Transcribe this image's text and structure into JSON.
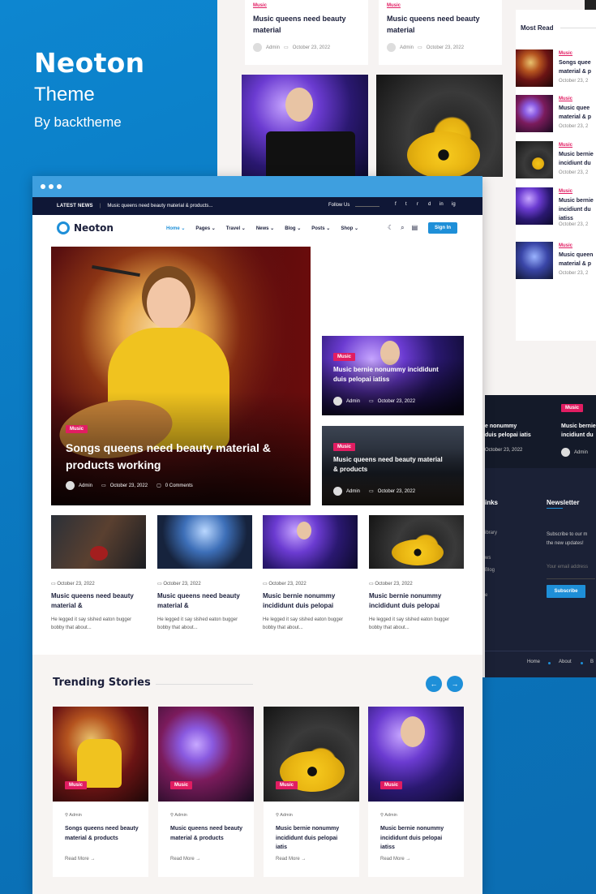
{
  "brand": {
    "name": "Neoton",
    "theme": "Theme",
    "by": "By backtheme"
  },
  "back": {
    "cards": [
      {
        "tag": "Music",
        "title": "Music queens need beauty material",
        "author": "Admin",
        "date": "October 23, 2022"
      },
      {
        "tag": "Music",
        "title": "Music queens need beauty material",
        "author": "Admin",
        "date": "October 23, 2022"
      }
    ],
    "most_read_title": "Most Read",
    "most_read": [
      {
        "tag": "Music",
        "title": "Songs quee material & p",
        "date": "October 23, 2"
      },
      {
        "tag": "Music",
        "title": "Music quee material & p",
        "date": "October 23, 2"
      },
      {
        "tag": "Music",
        "title": "Music bernie incidiunt du",
        "date": "October 23, 2"
      },
      {
        "tag": "Music",
        "title": "Music bernie incidiunt du iatiss",
        "date": "October 23, 2"
      },
      {
        "tag": "Music",
        "title": "Music queen material & p",
        "date": "October 23, 2"
      }
    ],
    "dark_left_title": "e nonummy\nduis pelopai iatis",
    "dark_left_date": "October 23, 2022",
    "dark_right_tag": "Music",
    "dark_right_title": "Music bernie incidiunt du",
    "dark_right_author": "Admin",
    "footer_links_title": "inks",
    "footer_links": [
      "ibrary",
      "ws",
      "Blog",
      "e"
    ],
    "newsletter_title": "Newsletter",
    "newsletter_text": "Subscribe to our m the new updates!",
    "newsletter_placeholder": "Your email address",
    "subscribe_label": "Subscribe",
    "footer_nav": [
      "Home",
      "About",
      "B"
    ]
  },
  "front": {
    "topbar": {
      "latest": "LATEST NEWS",
      "ticker": "Music queens need beauty material & products...",
      "follow": "Follow Us",
      "social": [
        "f",
        "t",
        "r",
        "d",
        "in",
        "ig"
      ]
    },
    "logo": "Neoton",
    "menu": [
      "Home",
      "Pages",
      "Travel",
      "News",
      "Blog",
      "Posts",
      "Shop"
    ],
    "signin": "Sign In",
    "hero": {
      "tag": "Music",
      "title": "Songs queens need beauty material & products working",
      "author": "Admin",
      "date": "October 23, 2022",
      "comments": "0 Comments"
    },
    "side": [
      {
        "tag": "Music",
        "title": "Music bernie nonummy incididunt duis pelopai iatiss",
        "author": "Admin",
        "date": "October 23, 2022"
      },
      {
        "tag": "Music",
        "title": "Music queens need beauty material & products",
        "author": "Admin",
        "date": "October 23, 2022"
      }
    ],
    "grid": [
      {
        "date": "October 23, 2022",
        "title": "Music queens need beauty material &",
        "excerpt": "He legged it say slshed eaton bugger bobby that about..."
      },
      {
        "date": "October 23, 2022",
        "title": "Music queens need beauty material &",
        "excerpt": "He legged it say slshed eaton bugger bobby that about..."
      },
      {
        "date": "October 23, 2022",
        "title": "Music bernie nonummy incididunt duis pelopai",
        "excerpt": "He legged it say slshed eaton bugger bobby that about..."
      },
      {
        "date": "October 23, 2022",
        "title": "Music bernie nonummy incididunt duis pelopai",
        "excerpt": "He legged it say slshed eaton bugger bobby that about..."
      }
    ],
    "trending_title": "Trending Stories",
    "trending": [
      {
        "tag": "Music",
        "author": "Admin",
        "title": "Songs queens need beauty material & products",
        "read": "Read More"
      },
      {
        "tag": "Music",
        "author": "Admin",
        "title": "Music queens need beauty material & products",
        "read": "Read More"
      },
      {
        "tag": "Music",
        "author": "Admin",
        "title": "Music bernie nonummy incididunt duis pelopai iatis",
        "read": "Read More"
      },
      {
        "tag": "Music",
        "author": "Admin",
        "title": "Music bernie nonummy incididunt duis pelopai iatiss",
        "read": "Read More"
      }
    ]
  }
}
